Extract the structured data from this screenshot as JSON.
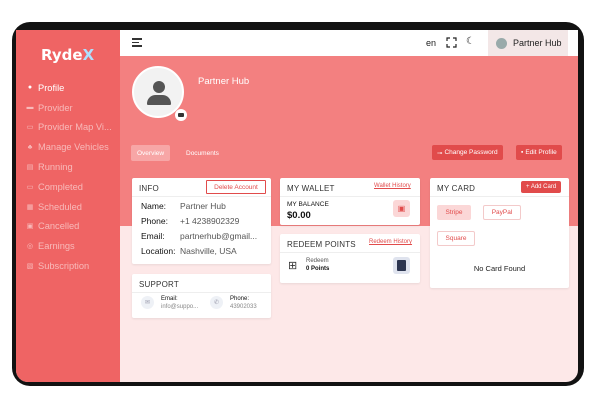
{
  "app": {
    "logo_prefix": "Ryde",
    "logo_suffix": "X"
  },
  "sidebar": {
    "items": [
      {
        "label": "Profile",
        "icon": "user-icon",
        "active": true
      },
      {
        "label": "Provider",
        "icon": "car-icon"
      },
      {
        "label": "Provider Map Vi...",
        "icon": "map-icon"
      },
      {
        "label": "Manage Vehicles",
        "icon": "vehicle-icon"
      },
      {
        "label": "Running",
        "icon": "running-icon"
      },
      {
        "label": "Completed",
        "icon": "completed-icon"
      },
      {
        "label": "Scheduled",
        "icon": "calendar-icon"
      },
      {
        "label": "Cancelled",
        "icon": "cancel-icon"
      },
      {
        "label": "Earnings",
        "icon": "earnings-icon"
      },
      {
        "label": "Subscription",
        "icon": "subscription-icon"
      }
    ]
  },
  "topbar": {
    "language": "en",
    "user_name": "Partner Hub"
  },
  "hero": {
    "name": "Partner Hub",
    "tabs": [
      "Overview",
      "Documents"
    ],
    "change_password": "Change Password",
    "edit_profile": "Edit Profile"
  },
  "info": {
    "title": "INFO",
    "delete_account": "Delete Account",
    "rows": [
      {
        "label": "Name:",
        "value": "Partner Hub"
      },
      {
        "label": "Phone:",
        "value": "+1 4238902329"
      },
      {
        "label": "Email:",
        "value": "partnerhub@gmail..."
      },
      {
        "label": "Location:",
        "value": "Nashville, USA"
      }
    ]
  },
  "support": {
    "title": "SUPPORT",
    "email_label": "Email:",
    "email_value": "info@suppo...",
    "phone_label": "Phone:",
    "phone_value": "43902033"
  },
  "wallet": {
    "title": "MY WALLET",
    "history_link": "Wallet History",
    "balance_label": "MY BALANCE",
    "balance_value": "$0.00"
  },
  "redeem": {
    "title": "REDEEM POINTS",
    "history_link": "Redeem History",
    "label": "Redeem",
    "points": "0 Points"
  },
  "card": {
    "title": "MY CARD",
    "add_card": "+ Add Card",
    "options": [
      "Stripe",
      "PayPal",
      "Square"
    ],
    "empty": "No Card Found"
  },
  "colors": {
    "accent": "#e14b4b",
    "sidebar": "#ef6464",
    "hero": "#f38080",
    "background": "#fde8e8"
  }
}
